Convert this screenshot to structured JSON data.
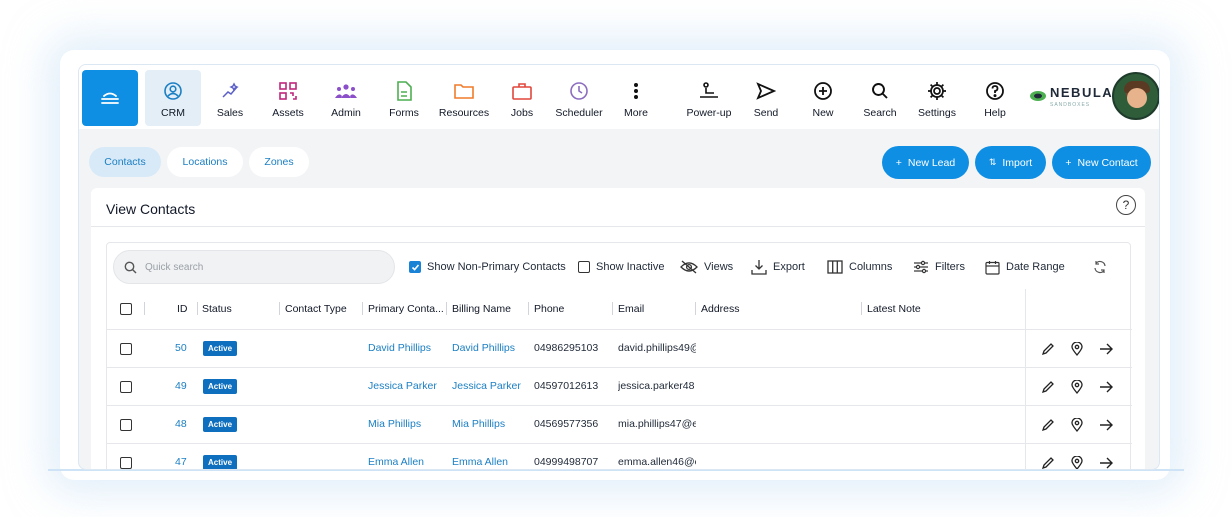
{
  "nav": {
    "items": [
      {
        "label": "CRM",
        "icon": "person-circle-icon"
      },
      {
        "label": "Sales",
        "icon": "sparkle-chart-icon"
      },
      {
        "label": "Assets",
        "icon": "qr-code-icon"
      },
      {
        "label": "Admin",
        "icon": "group-icon"
      },
      {
        "label": "Forms",
        "icon": "document-icon"
      },
      {
        "label": "Resources",
        "icon": "folder-icon"
      },
      {
        "label": "Jobs",
        "icon": "briefcase-icon"
      },
      {
        "label": "Scheduler",
        "icon": "clock-icon"
      },
      {
        "label": "More",
        "icon": "more-vertical-icon"
      },
      {
        "label": "Power-up",
        "icon": "power-up-icon"
      },
      {
        "label": "Send",
        "icon": "send-icon"
      },
      {
        "label": "New",
        "icon": "plus-circle-icon"
      },
      {
        "label": "Search",
        "icon": "search-icon"
      },
      {
        "label": "Settings",
        "icon": "gear-icon"
      },
      {
        "label": "Help",
        "icon": "help-icon"
      }
    ],
    "active": "CRM",
    "brand": "NEBULA",
    "brand_sub": "SANDBOXES"
  },
  "tabs": [
    "Contacts",
    "Locations",
    "Zones"
  ],
  "actions": {
    "new_lead": "New Lead",
    "import": "Import",
    "new_contact": "New Contact"
  },
  "card": {
    "title": "View Contacts",
    "help": "?"
  },
  "toolbar": {
    "search_placeholder": "Quick search",
    "show_non_primary": "Show Non-Primary Contacts",
    "show_non_primary_checked": true,
    "show_inactive": "Show Inactive",
    "show_inactive_checked": false,
    "views": "Views",
    "export": "Export",
    "columns": "Columns",
    "filters": "Filters",
    "date_range": "Date Range"
  },
  "table": {
    "headers": [
      "ID",
      "Status",
      "Contact Type",
      "Primary Conta...",
      "Billing Name",
      "Phone",
      "Email",
      "Address",
      "Latest Note"
    ],
    "rows": [
      {
        "id": "50",
        "status": "Active",
        "contact_type": "",
        "primary_contact": "David Phillips",
        "billing_name": "David Phillips",
        "phone": "04986295103",
        "email": "david.phillips49@",
        "address": "",
        "latest_note": ""
      },
      {
        "id": "49",
        "status": "Active",
        "contact_type": "",
        "primary_contact": "Jessica Parker",
        "billing_name": "Jessica Parker",
        "phone": "04597012613",
        "email": "jessica.parker48",
        "address": "",
        "latest_note": ""
      },
      {
        "id": "48",
        "status": "Active",
        "contact_type": "",
        "primary_contact": "Mia Phillips",
        "billing_name": "Mia Phillips",
        "phone": "04569577356",
        "email": "mia.phillips47@e",
        "address": "",
        "latest_note": ""
      },
      {
        "id": "47",
        "status": "Active",
        "contact_type": "",
        "primary_contact": "Emma Allen",
        "billing_name": "Emma Allen",
        "phone": "04999498707",
        "email": "emma.allen46@e",
        "address": "",
        "latest_note": ""
      }
    ]
  },
  "colors": {
    "accent": "#0f8fe3",
    "link": "#1b7fc4",
    "badge": "#0d6fbe"
  }
}
